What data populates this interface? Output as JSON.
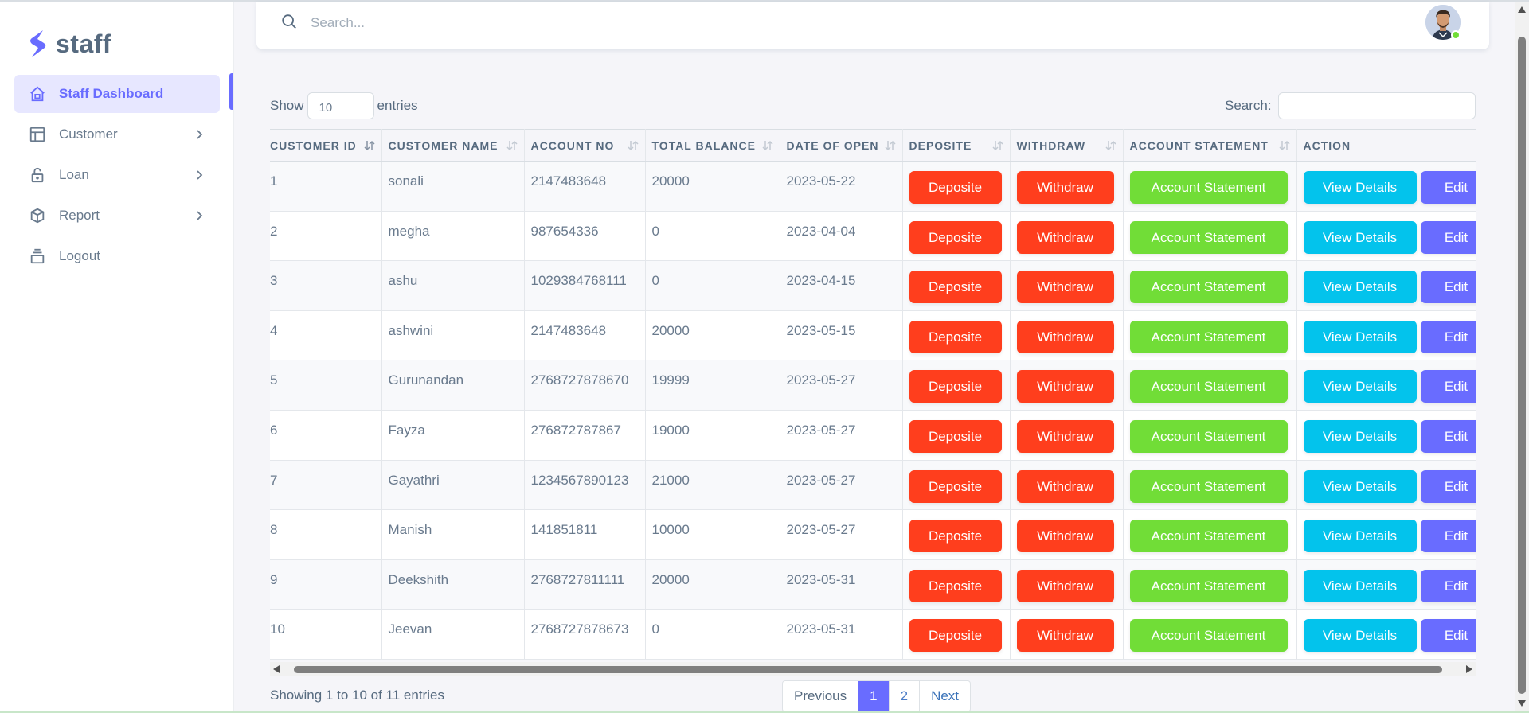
{
  "brand": {
    "name": "staff"
  },
  "sidebar": {
    "items": [
      {
        "label": "Staff Dashboard",
        "icon": "home-icon",
        "active": true
      },
      {
        "label": "Customer",
        "icon": "layout-icon",
        "has_children": true
      },
      {
        "label": "Loan",
        "icon": "lock-icon",
        "has_children": true
      },
      {
        "label": "Report",
        "icon": "cube-icon",
        "has_children": true
      },
      {
        "label": "Logout",
        "icon": "collection-icon",
        "has_children": false
      }
    ]
  },
  "navbar": {
    "search_placeholder": "Search...",
    "user_status": "online",
    "status_color": "#71dd37"
  },
  "table_controls": {
    "show_label": "Show",
    "page_length": "10",
    "entries_label": "entries",
    "search_label": "Search:",
    "search_value": ""
  },
  "table": {
    "columns": [
      "CUSTOMER ID",
      "CUSTOMER NAME",
      "ACCOUNT NO",
      "TOTAL BALANCE",
      "DATE OF OPEN",
      "DEPOSITE",
      "WITHDRAW",
      "ACCOUNT STATEMENT",
      "ACTION"
    ],
    "rows": [
      {
        "id": "1",
        "name": "sonali",
        "account_no": "2147483648",
        "balance": "20000",
        "date_of_open": "2023-05-22"
      },
      {
        "id": "2",
        "name": "megha",
        "account_no": "987654336",
        "balance": "0",
        "date_of_open": "2023-04-04"
      },
      {
        "id": "3",
        "name": "ashu",
        "account_no": "1029384768111",
        "balance": "0",
        "date_of_open": "2023-04-15"
      },
      {
        "id": "4",
        "name": "ashwini",
        "account_no": "2147483648",
        "balance": "20000",
        "date_of_open": "2023-05-15"
      },
      {
        "id": "5",
        "name": "Gurunandan",
        "account_no": "2768727878670",
        "balance": "19999",
        "date_of_open": "2023-05-27"
      },
      {
        "id": "6",
        "name": "Fayza",
        "account_no": "276872787867",
        "balance": "19000",
        "date_of_open": "2023-05-27"
      },
      {
        "id": "7",
        "name": "Gayathri",
        "account_no": "1234567890123",
        "balance": "21000",
        "date_of_open": "2023-05-27"
      },
      {
        "id": "8",
        "name": "Manish",
        "account_no": "141851811",
        "balance": "10000",
        "date_of_open": "2023-05-27"
      },
      {
        "id": "9",
        "name": "Deekshith",
        "account_no": "2768727811111",
        "balance": "20000",
        "date_of_open": "2023-05-31"
      },
      {
        "id": "10",
        "name": "Jeevan",
        "account_no": "2768727878673",
        "balance": "0",
        "date_of_open": "2023-05-31"
      }
    ],
    "buttons": {
      "deposite": "Deposite",
      "withdraw": "Withdraw",
      "statement": "Account Statement",
      "view": "View Details",
      "edit": "Edit"
    }
  },
  "footer": {
    "info": "Showing 1 to 10 of 11 entries",
    "pagination": {
      "previous": "Previous",
      "pages": [
        "1",
        "2"
      ],
      "current": "1",
      "next": "Next"
    }
  },
  "colors": {
    "primary": "#696cff",
    "danger": "#ff3e1d",
    "success": "#71dd37",
    "info": "#03c3ec"
  }
}
